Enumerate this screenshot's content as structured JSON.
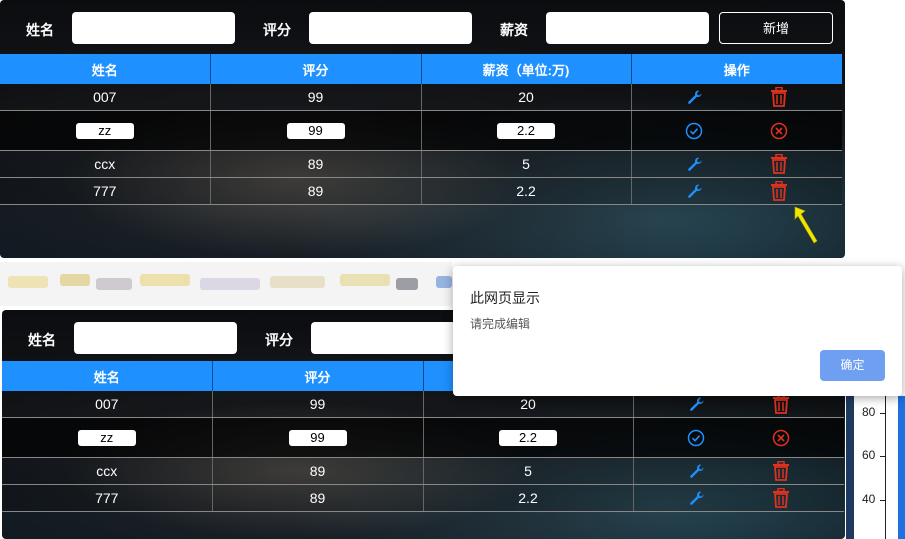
{
  "form": {
    "name_label": "姓名",
    "score_label": "评分",
    "salary_label": "薪资",
    "add_button": "新增"
  },
  "table": {
    "headers": [
      "姓名",
      "评分",
      "薪资（单位:万)",
      "操作"
    ],
    "rows": [
      {
        "name": "007",
        "score": "99",
        "salary": "20",
        "editing": false
      },
      {
        "name": "zz",
        "score": "99",
        "salary": "2.2",
        "editing": true
      },
      {
        "name": "ccx",
        "score": "89",
        "salary": "5",
        "editing": false
      },
      {
        "name": "777",
        "score": "89",
        "salary": "2.2",
        "editing": false
      }
    ]
  },
  "dialog": {
    "title": "此网页显示",
    "message": "请完成编辑",
    "ok_label": "确定"
  },
  "side_axis": {
    "ticks": [
      "80",
      "60",
      "40"
    ]
  },
  "colors": {
    "header_blue": "#1e90ff",
    "edit_icon": "#1e90ff",
    "delete_icon": "#e0301e",
    "cursor": "#f2e600"
  },
  "icons": {
    "edit": "wrench-icon",
    "delete": "trash-icon",
    "confirm": "check-circle-icon",
    "cancel": "x-circle-icon"
  }
}
